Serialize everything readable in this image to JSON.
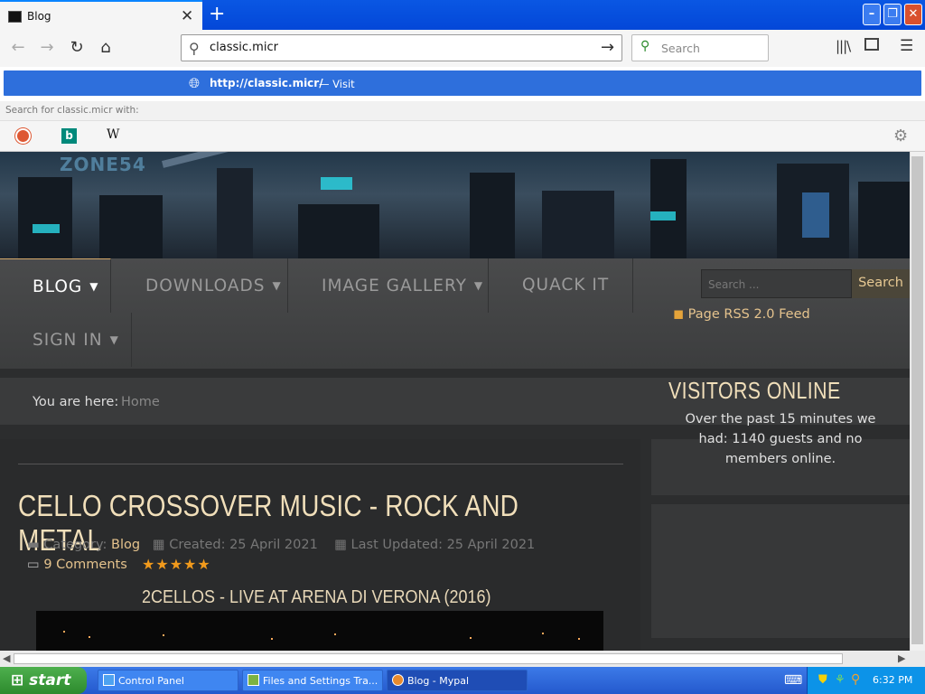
{
  "browser": {
    "tab_title": "Blog",
    "address_value": "classic.micr",
    "search_placeholder": "Search",
    "suggestion_url_host": "http://classic.micr/",
    "suggestion_action": "— Visit",
    "search_for_label": "Search for classic.micr with:",
    "engines": [
      "DuckDuckGo",
      "Bing",
      "Wikipedia"
    ]
  },
  "site": {
    "logo": "ZONE54",
    "menu": {
      "blog": "BLOG",
      "downloads": "DOWNLOADS",
      "gallery": "IMAGE GALLERY",
      "quack": "QUACK IT",
      "signin": "SIGN IN"
    },
    "search_placeholder": "Search ...",
    "search_button": "Search",
    "breadcrumb_label": "You are here:",
    "breadcrumb_home": "Home"
  },
  "article": {
    "title": "CELLO CROSSOVER MUSIC - ROCK AND METAL",
    "category_label": "Category:",
    "category": "Blog",
    "created": "Created: 25 April 2021",
    "updated": "Last Updated: 25 April 2021",
    "comments": "9 Comments",
    "rating_stars": 5,
    "stars_text": "★★★★★",
    "subtitle": "2CELLOS - LIVE AT ARENA DI VERONA (2016)"
  },
  "sidebar": {
    "rss": "Page RSS 2.0 Feed",
    "visitors_title": "VISITORS ONLINE",
    "visitors_text": "Over the past 15 minutes we had: 1140 guests and no members online."
  },
  "taskbar": {
    "start": "start",
    "items": [
      "Control Panel",
      "Files and Settings Tra...",
      "Blog - Mypal"
    ],
    "clock": "6:32 PM"
  },
  "colors": {
    "accent": "#e5c38d",
    "title": "#f1dfba",
    "suggest_bg": "#2e6fdc"
  }
}
